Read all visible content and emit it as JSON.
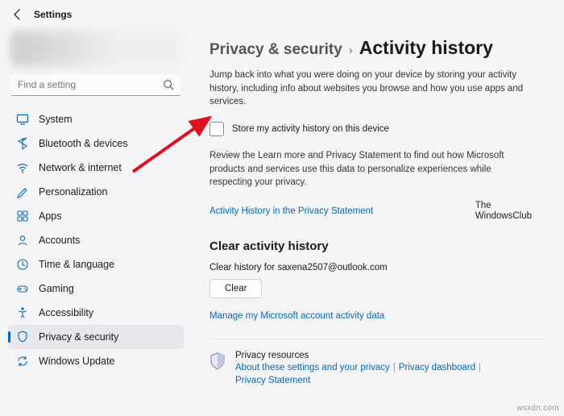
{
  "header": {
    "title": "Settings"
  },
  "search": {
    "placeholder": "Find a setting"
  },
  "sidebar": {
    "items": [
      {
        "label": "System",
        "icon": "system-icon"
      },
      {
        "label": "Bluetooth & devices",
        "icon": "bluetooth-icon"
      },
      {
        "label": "Network & internet",
        "icon": "wifi-icon"
      },
      {
        "label": "Personalization",
        "icon": "personalization-icon"
      },
      {
        "label": "Apps",
        "icon": "apps-icon"
      },
      {
        "label": "Accounts",
        "icon": "accounts-icon"
      },
      {
        "label": "Time & language",
        "icon": "time-icon"
      },
      {
        "label": "Gaming",
        "icon": "gaming-icon"
      },
      {
        "label": "Accessibility",
        "icon": "accessibility-icon"
      },
      {
        "label": "Privacy & security",
        "icon": "privacy-icon"
      },
      {
        "label": "Windows Update",
        "icon": "update-icon"
      }
    ],
    "active_index": 9
  },
  "breadcrumb": {
    "parent": "Privacy & security",
    "sep": "›",
    "current": "Activity history"
  },
  "intro": "Jump back into what you were doing on your device by storing your activity history, including info about websites you browse and how you use apps and services.",
  "checkbox": {
    "label": "Store my activity history on this device",
    "checked": false
  },
  "review": "Review the Learn more and Privacy Statement to find out how Microsoft products and services use this data to personalize experiences while respecting your privacy.",
  "link_privacy_statement": "Activity History in the Privacy Statement",
  "attribution": {
    "line1": "The",
    "line2": "WindowsClub"
  },
  "clear": {
    "heading": "Clear activity history",
    "line": "Clear history for saxena2507@outlook.com",
    "button": "Clear"
  },
  "manage_link": "Manage my Microsoft account activity data",
  "resources": {
    "title": "Privacy resources",
    "links": [
      "About these settings and your privacy",
      "Privacy dashboard",
      "Privacy Statement"
    ]
  },
  "watermark": "wsxdn.com"
}
